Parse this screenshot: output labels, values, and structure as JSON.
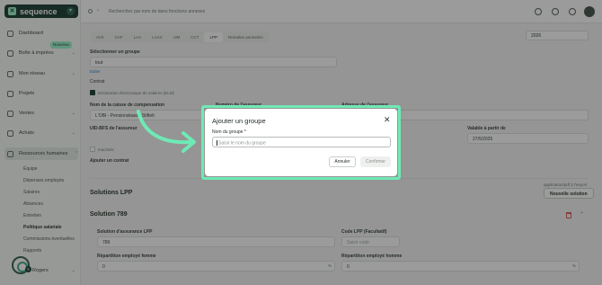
{
  "app": {
    "logo_text": "sequence",
    "logo_mark": "✕"
  },
  "sidebar": {
    "items": [
      {
        "label": "Dashboard",
        "icon": "home-icon"
      },
      {
        "label": "Boîte à imprévu",
        "icon": "inbox-icon",
        "badge": "Nouveau"
      },
      {
        "label": "Mon réseau",
        "icon": "network-icon"
      },
      {
        "label": "Projets",
        "icon": "folder-icon"
      },
      {
        "label": "Ventes",
        "icon": "sales-icon"
      },
      {
        "label": "Achats",
        "icon": "cart-icon"
      },
      {
        "label": "Ressources humaines",
        "icon": "people-icon"
      }
    ],
    "sub_items": [
      "Équipe",
      "Dépenses employés",
      "Salaires",
      "Absences",
      "Entretien",
      "Politique salariale",
      "Commissions éventuelles",
      "Rapports"
    ],
    "bottom_item": "Rogers",
    "help_count": "5"
  },
  "topbar": {
    "search_placeholder": "Recherchez par nom de dans fonctions annexes"
  },
  "main": {
    "tabs": [
      "AVS",
      "CAF",
      "LAA",
      "LAAC",
      "IJM",
      "CCT",
      "LPP",
      "Retraites annexées"
    ],
    "selected_tab": "LPP",
    "year": "2026",
    "select_group_label": "Sélectionner un groupe",
    "select_group_value": "tout",
    "edit_link": "Éditer",
    "contract_label": "Contrat",
    "declaration_label": "Déclaration électronique de salaires (ELM)",
    "fund_name_label": "Nom de la caisse de compensation",
    "fund_number_label": "Numéro de l'assureur",
    "fund_address_label": "Adresse de l'assureur",
    "fund_name_value": "L'OBI - Pensionskasse Stiftelt",
    "uid_label": "UID-BFS de l'assureur",
    "valid_from_label": "Valable à partir de",
    "valid_from_value": "27/5/2025",
    "inactive_label": "Inactivés",
    "add_contract_label": "Ajouter un contrat",
    "solutions_title": "Solutions LPP",
    "new_solution_hint": "application/pdf à l'export",
    "new_solution_button": "Nouvelle solution",
    "solution_name": "Solution 789",
    "insurance_solution_label": "Solution d'assurance LPP",
    "insurance_solution_value": "789",
    "code_label": "Code LPP (Facultatif)",
    "code_placeholder": "Saisir code",
    "split_women_label": "Répartition employé femme",
    "split_women_value": "0",
    "split_men_label": "Répartition employé homme",
    "split_men_value": "0",
    "percent_symbol": "%"
  },
  "modal": {
    "title": "Ajouter un groupe",
    "field_label": "Nom du groupe *",
    "placeholder": "Saisir le nom du groupe",
    "cancel": "Annuler",
    "confirm": "Confirmer"
  },
  "colors": {
    "brand_dark": "#12332a",
    "accent": "#6fe9b6",
    "overlay": "rgba(30,34,32,0.45)"
  }
}
